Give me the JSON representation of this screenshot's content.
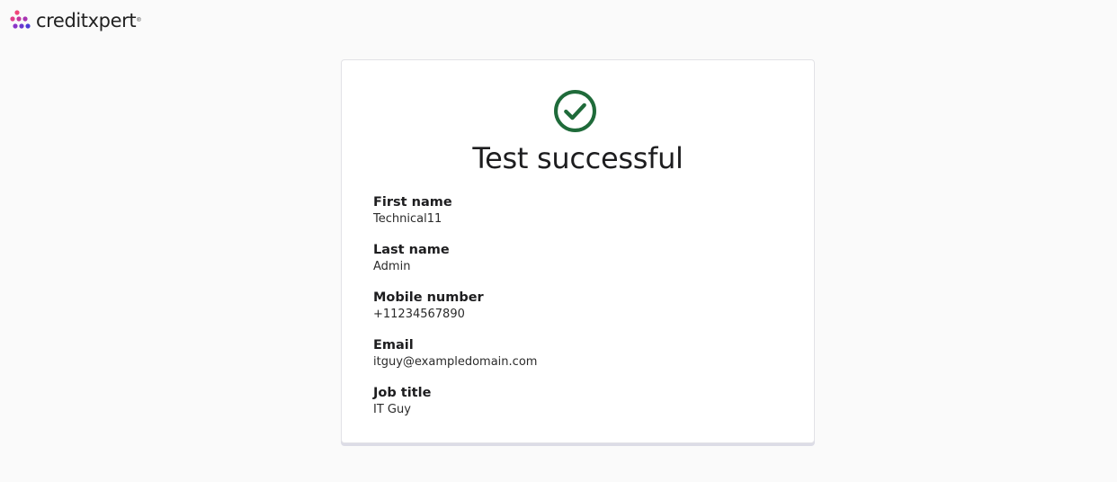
{
  "brand": {
    "name": "creditxpert",
    "trademark": "®",
    "colors": [
      "#f0457a",
      "#c2359e",
      "#8a35c8",
      "#4b3bd6"
    ]
  },
  "status": {
    "icon": "check-circle-icon",
    "color": "#1f6b3a",
    "title": "Test successful"
  },
  "fields": [
    {
      "label": "First name",
      "value": "Technical11"
    },
    {
      "label": "Last name",
      "value": "Admin"
    },
    {
      "label": "Mobile number",
      "value": "+11234567890"
    },
    {
      "label": "Email",
      "value": "itguy@exampledomain.com"
    },
    {
      "label": "Job title",
      "value": "IT Guy"
    }
  ]
}
